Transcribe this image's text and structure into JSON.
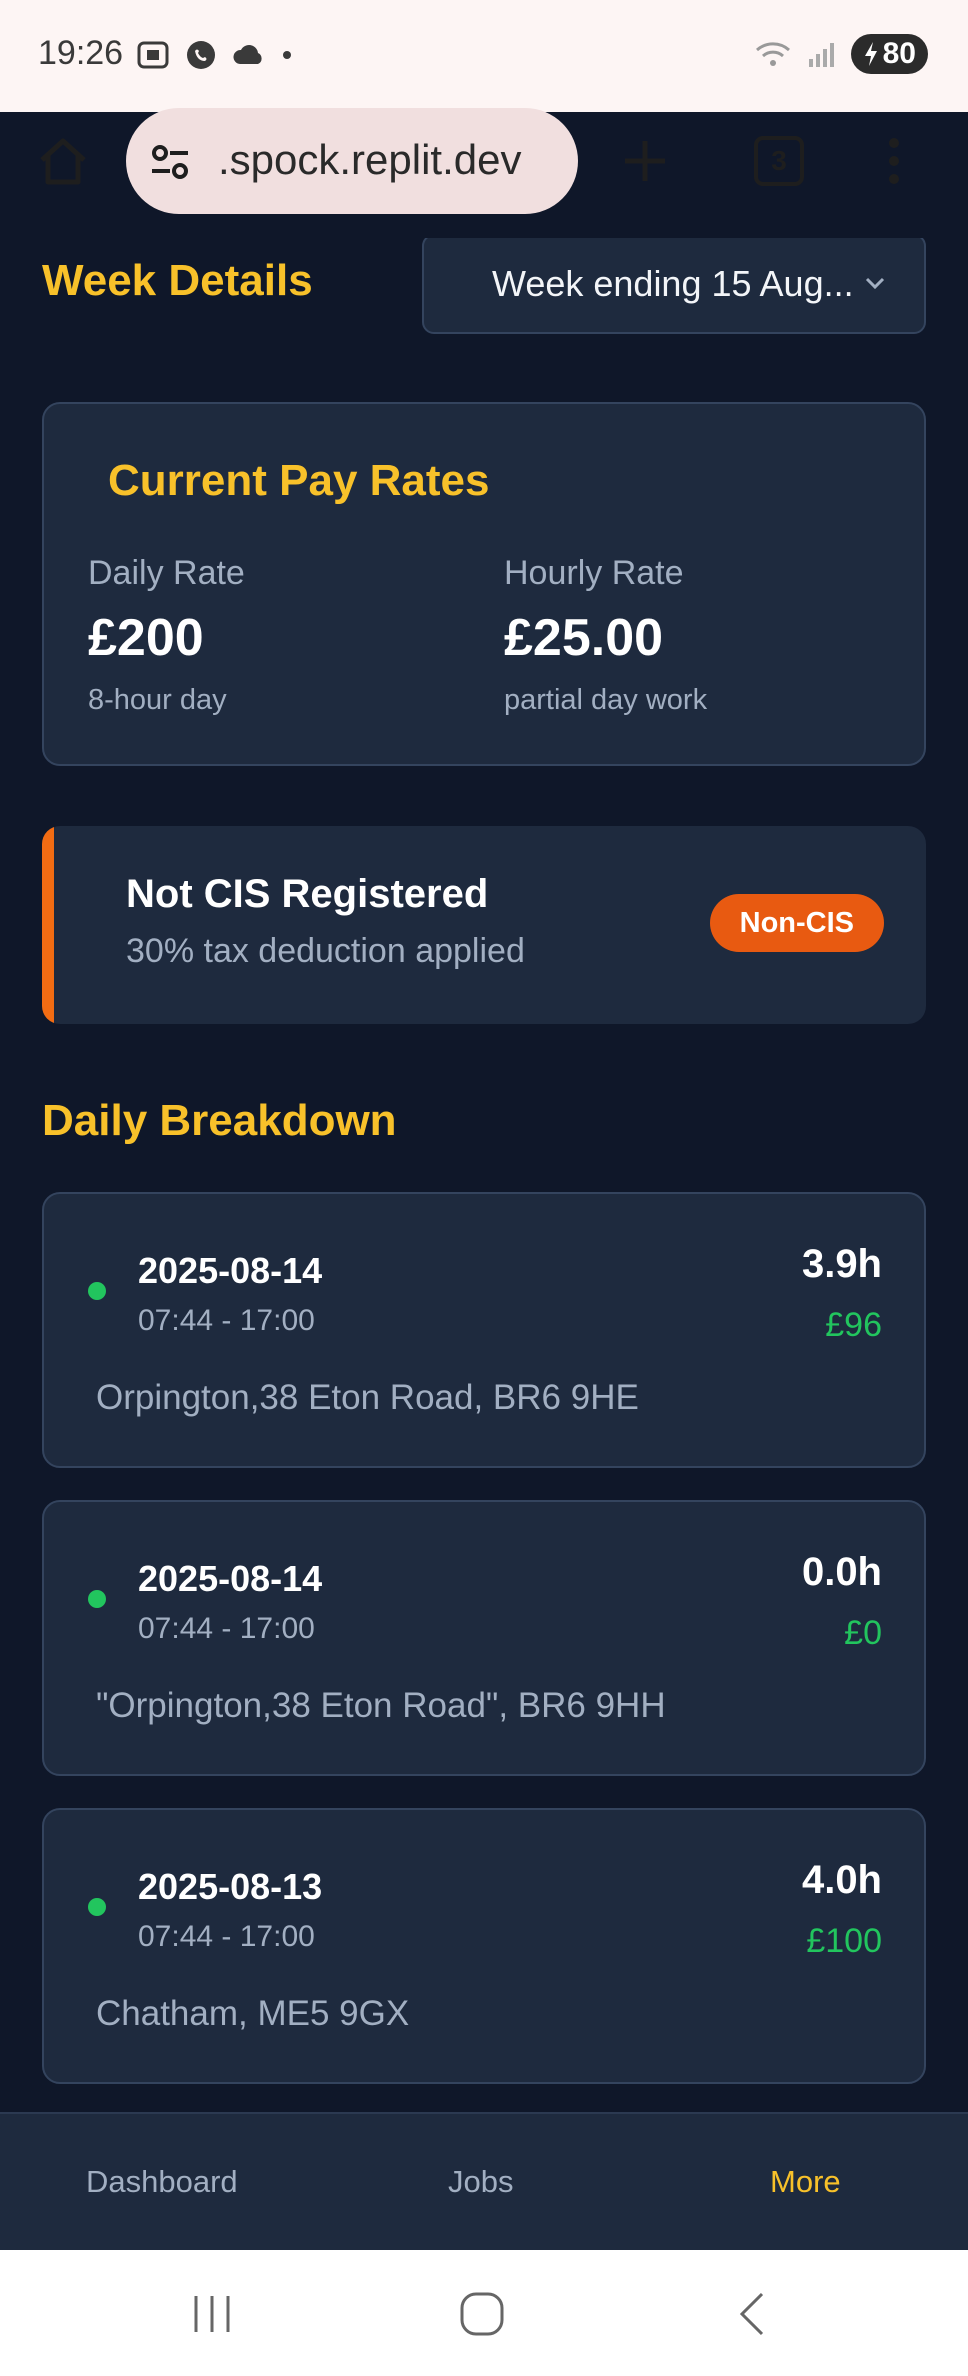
{
  "status_bar": {
    "time": "19:26",
    "battery": "80",
    "icons_left": [
      "screenshot-icon",
      "whatsapp-icon",
      "cloud-icon",
      "dot-icon"
    ],
    "icons_right": [
      "wifi-icon",
      "signal-icon",
      "battery-icon"
    ]
  },
  "browser": {
    "url": ".spock.replit.dev",
    "tab_count": "3"
  },
  "week_details": {
    "title": "Week Details",
    "selected_week": "Week ending 15 Aug..."
  },
  "pay_rates": {
    "title": "Current Pay Rates",
    "daily": {
      "label": "Daily Rate",
      "value": "£200",
      "note": "8-hour day"
    },
    "hourly": {
      "label": "Hourly Rate",
      "value": "£25.00",
      "note": "partial day work"
    }
  },
  "cis": {
    "title": "Not CIS Registered",
    "subtitle": "30% tax deduction applied",
    "badge": "Non-CIS",
    "accent_color": "#f26c13"
  },
  "daily_breakdown": {
    "title": "Daily Breakdown",
    "entries": [
      {
        "date": "2025-08-14",
        "time": "07:44 - 17:00",
        "hours": "3.9h",
        "pay": "£96",
        "location": "Orpington,38 Eton Road, BR6 9HE"
      },
      {
        "date": "2025-08-14",
        "time": "07:44 - 17:00",
        "hours": "0.0h",
        "pay": "£0",
        "location": "\"Orpington,38 Eton Road\", BR6 9HH"
      },
      {
        "date": "2025-08-13",
        "time": "07:44 - 17:00",
        "hours": "4.0h",
        "pay": "£100",
        "location": "Chatham, ME5 9GX"
      }
    ]
  },
  "bottom_nav": {
    "items": [
      {
        "label": "Dashboard",
        "active": false
      },
      {
        "label": "Jobs",
        "active": false
      },
      {
        "label": "More",
        "active": true
      }
    ]
  },
  "colors": {
    "background": "#0f1729",
    "card": "#1e2a3e",
    "accent_yellow": "#f8c12a",
    "success_green": "#22c55e",
    "badge_orange": "#e85a11"
  }
}
